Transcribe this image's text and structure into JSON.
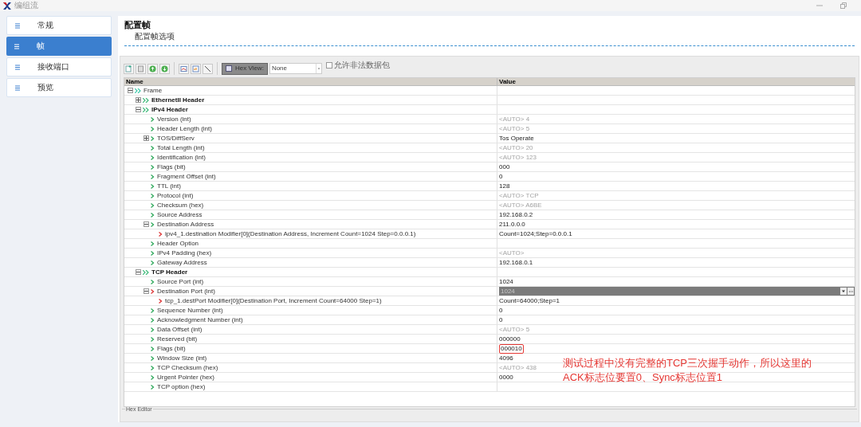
{
  "window": {
    "title": "编组流"
  },
  "sidebar": {
    "items": [
      {
        "label": "常规",
        "selected": false
      },
      {
        "label": "帧",
        "selected": true
      },
      {
        "label": "接收端口",
        "selected": false
      },
      {
        "label": "预览",
        "selected": false
      }
    ]
  },
  "header": {
    "title": "配置帧",
    "subtitle": "配置帧选项"
  },
  "toolbar": {
    "hex_view": "Hex View:",
    "select_value": "None",
    "checkbox": {
      "label": "允许非法数据包",
      "checked": false
    }
  },
  "table": {
    "columns": [
      "Name",
      "Value"
    ],
    "rows": [
      {
        "name": "Frame",
        "kind": "root",
        "expanded": true,
        "children": [
          {
            "name": "EthernetII Header",
            "kind": "group",
            "expanded": false
          },
          {
            "name": "IPv4 Header",
            "kind": "group",
            "expanded": true,
            "children": [
              {
                "name": "Version (int)",
                "kind": "field",
                "value": "<AUTO> 4",
                "auto": true
              },
              {
                "name": "Header Length (int)",
                "kind": "field",
                "value": "<AUTO> 5",
                "auto": true
              },
              {
                "name": "TOS/DiffServ",
                "kind": "field",
                "value": "Tos Operate",
                "auto": false,
                "expanded": false
              },
              {
                "name": "Total Length (int)",
                "kind": "field",
                "value": "<AUTO> 20",
                "auto": true
              },
              {
                "name": "Identification  (int)",
                "kind": "field",
                "value": "<AUTO> 123",
                "auto": true
              },
              {
                "name": "Flags (bit)",
                "kind": "field",
                "value": "000",
                "auto": false
              },
              {
                "name": "Fragment Offset (int)",
                "kind": "field",
                "value": "0",
                "auto": false
              },
              {
                "name": "TTL (int)",
                "kind": "field",
                "value": "128",
                "auto": false
              },
              {
                "name": "Protocol (int)",
                "kind": "field",
                "value": "<AUTO> TCP",
                "auto": true
              },
              {
                "name": "Checksum (hex)",
                "kind": "field",
                "value": "<AUTO> A6BE",
                "auto": true
              },
              {
                "name": "Source Address",
                "kind": "field",
                "value": "192.168.0.2",
                "auto": false
              },
              {
                "name": "Destination Address",
                "kind": "field",
                "value": "211.0.0.0",
                "auto": false,
                "expanded": true,
                "children": [
                  {
                    "name": "ipv4_1.destination Modifier[0](Destination Address, Increment Count=1024 Step=0.0.0.1)",
                    "kind": "modifier",
                    "value": "Count=1024;Step=0.0.0.1",
                    "auto": false
                  }
                ]
              },
              {
                "name": "Header Option",
                "kind": "field"
              },
              {
                "name": "IPv4 Padding (hex)",
                "kind": "field",
                "value": "<AUTO>",
                "auto": true
              },
              {
                "name": "Gateway Address",
                "kind": "field",
                "value": "192.168.0.1",
                "auto": false
              }
            ]
          },
          {
            "name": "TCP Header",
            "kind": "group",
            "expanded": true,
            "children": [
              {
                "name": "Source Port (int)",
                "kind": "field",
                "value": "1024",
                "auto": false
              },
              {
                "name": "Destination Port (int)",
                "kind": "modifier",
                "value": "1024",
                "editing": true,
                "expanded": true,
                "children": [
                  {
                    "name": "tcp_1.destPort Modifier[0](Destination Port, Increment Count=64000 Step=1)",
                    "kind": "modifier",
                    "value": "Count=64000;Step=1",
                    "auto": false
                  }
                ]
              },
              {
                "name": "Sequence Number (int)",
                "kind": "field",
                "value": "0",
                "auto": false
              },
              {
                "name": "Acknowledgment Number (int)",
                "kind": "field",
                "value": "0",
                "auto": false
              },
              {
                "name": "Data Offset (int)",
                "kind": "field",
                "value": "<AUTO> 5",
                "auto": true
              },
              {
                "name": "Reserved (bit)",
                "kind": "field",
                "value": "000000",
                "auto": false
              },
              {
                "name": "Flags (bit)",
                "kind": "field",
                "value": "000010",
                "auto": false,
                "highlighted": true
              },
              {
                "name": "Window Size (int)",
                "kind": "field",
                "value": "4096",
                "auto": false
              },
              {
                "name": "TCP Checksum (hex)",
                "kind": "field",
                "value": "<AUTO> 438",
                "auto": true
              },
              {
                "name": "Urgent Pointer (hex)",
                "kind": "field",
                "value": "0000",
                "auto": false
              },
              {
                "name": "TCP option (hex)",
                "kind": "field"
              }
            ]
          }
        ]
      }
    ]
  },
  "annotation": "测试过程中没有完整的TCP三次握手动作，所以这里的ACK标志位要置0、Sync标志位置1",
  "bottom_panel": {
    "title": "Hex Editor"
  }
}
